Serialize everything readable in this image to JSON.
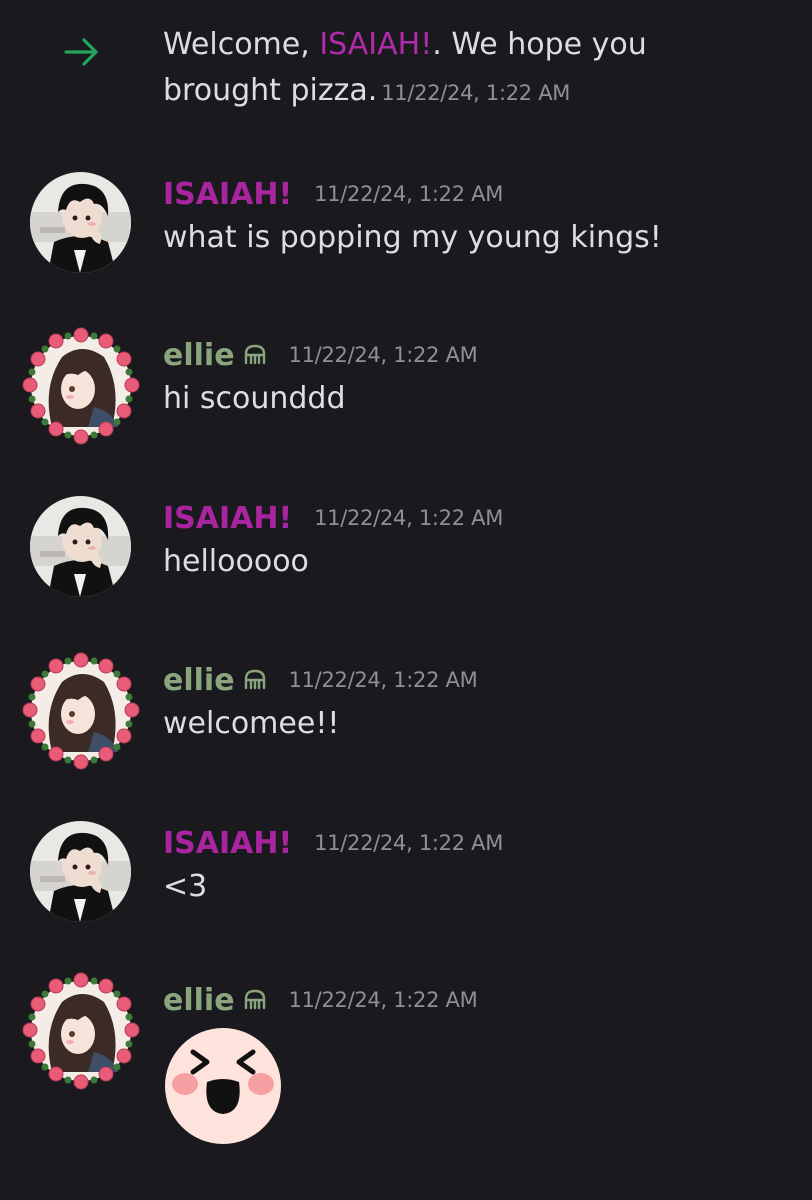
{
  "system": {
    "welcome_prefix": "Welcome, ",
    "welcome_name": "ISAIAH!",
    "welcome_suffix": ". We hope you brought pizza.",
    "timestamp": "11/22/24, 1:22 AM"
  },
  "colors": {
    "isaiah": "#a9249f",
    "ellie": "#8aa57e",
    "arrow": "#23a55a",
    "background": "#1a1a1e"
  },
  "messages": [
    {
      "author": "ISAIAH!",
      "timestamp": "11/22/24, 1:22 AM",
      "text": "what is popping my young kings!"
    },
    {
      "author": "ellie",
      "timestamp": "11/22/24, 1:22 AM",
      "text": "hi scounddd"
    },
    {
      "author": "ISAIAH!",
      "timestamp": "11/22/24, 1:22 AM",
      "text": "hellooooo"
    },
    {
      "author": "ellie",
      "timestamp": "11/22/24, 1:22 AM",
      "text": "welcomee!!"
    },
    {
      "author": "ISAIAH!",
      "timestamp": "11/22/24, 1:22 AM",
      "text": "<3"
    },
    {
      "author": "ellie",
      "timestamp": "11/22/24, 1:22 AM",
      "emoji": "excited-pink-face-emoji"
    }
  ]
}
